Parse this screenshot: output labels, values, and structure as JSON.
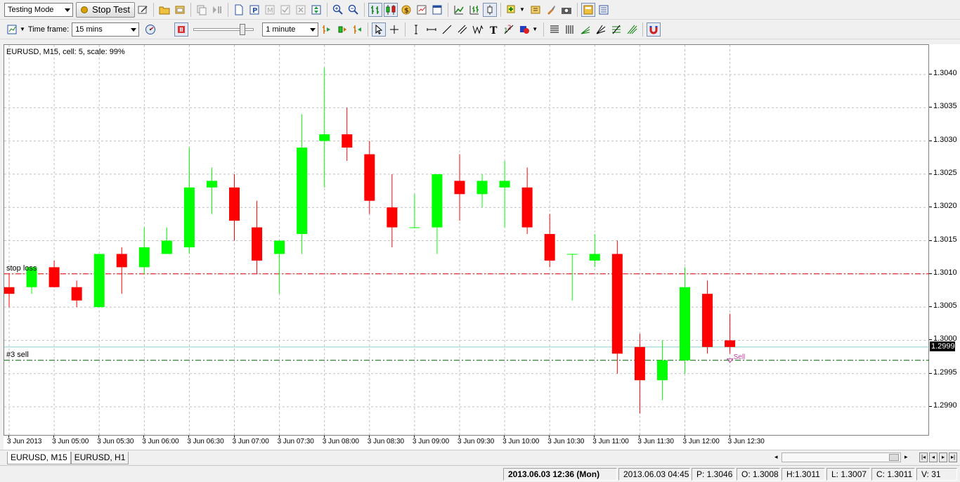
{
  "toolbar1": {
    "mode_select": "Testing Mode",
    "stop_test_label": "Stop Test"
  },
  "toolbar2": {
    "timeframe_label": "Time frame:",
    "timeframe_value": "15 mins",
    "speed_value": "1 minute"
  },
  "chart": {
    "caption": "EURUSD, M15, cell: 5, scale: 99%",
    "stop_loss_label": "stop loss",
    "order_label": "#3 sell",
    "sell_marker": "Sell",
    "current_price": "1.2999",
    "colors": {
      "bull": "#00ff00",
      "bear": "#ff0000",
      "grid": "#c0c0c0",
      "stoploss": "#e00000",
      "order": "#006000",
      "bidline": "#88d0d0"
    }
  },
  "chart_data": {
    "type": "candlestick",
    "symbol": "EURUSD",
    "timeframe": "M15",
    "ylim": [
      1.2986,
      1.3047
    ],
    "yticks": [
      "1.3040",
      "1.3035",
      "1.3030",
      "1.3025",
      "1.3020",
      "1.3015",
      "1.3010",
      "1.3005",
      "1.3000",
      "1.2995",
      "1.2990"
    ],
    "xticks": [
      "3 Jun 2013",
      "3 Jun 05:00",
      "3 Jun 05:30",
      "3 Jun 06:00",
      "3 Jun 06:30",
      "3 Jun 07:00",
      "3 Jun 07:30",
      "3 Jun 08:00",
      "3 Jun 08:30",
      "3 Jun 09:00",
      "3 Jun 09:30",
      "3 Jun 10:00",
      "3 Jun 10:30",
      "3 Jun 11:00",
      "3 Jun 11:30",
      "3 Jun 12:00",
      "3 Jun 12:30"
    ],
    "stop_loss": 1.301,
    "order_price": 1.2997,
    "bid": 1.2999,
    "candles": [
      {
        "o": 1.3008,
        "h": 1.301,
        "l": 1.3005,
        "c": 1.3007
      },
      {
        "o": 1.3008,
        "h": 1.3011,
        "l": 1.3007,
        "c": 1.3011
      },
      {
        "o": 1.3011,
        "h": 1.3012,
        "l": 1.3008,
        "c": 1.3008
      },
      {
        "o": 1.3008,
        "h": 1.3009,
        "l": 1.3005,
        "c": 1.3006
      },
      {
        "o": 1.3005,
        "h": 1.3013,
        "l": 1.3005,
        "c": 1.3013
      },
      {
        "o": 1.3013,
        "h": 1.3014,
        "l": 1.3007,
        "c": 1.3011
      },
      {
        "o": 1.3011,
        "h": 1.3017,
        "l": 1.301,
        "c": 1.3014
      },
      {
        "o": 1.3013,
        "h": 1.3017,
        "l": 1.3013,
        "c": 1.3015
      },
      {
        "o": 1.3014,
        "h": 1.3029,
        "l": 1.3013,
        "c": 1.3023
      },
      {
        "o": 1.3023,
        "h": 1.3026,
        "l": 1.3019,
        "c": 1.3024
      },
      {
        "o": 1.3023,
        "h": 1.3025,
        "l": 1.3015,
        "c": 1.3018
      },
      {
        "o": 1.3017,
        "h": 1.3021,
        "l": 1.301,
        "c": 1.3012
      },
      {
        "o": 1.3013,
        "h": 1.3015,
        "l": 1.3007,
        "c": 1.3015
      },
      {
        "o": 1.3016,
        "h": 1.3034,
        "l": 1.3013,
        "c": 1.3029
      },
      {
        "o": 1.303,
        "h": 1.3041,
        "l": 1.3023,
        "c": 1.3031
      },
      {
        "o": 1.3031,
        "h": 1.3035,
        "l": 1.3027,
        "c": 1.3029
      },
      {
        "o": 1.3028,
        "h": 1.303,
        "l": 1.3019,
        "c": 1.3021
      },
      {
        "o": 1.302,
        "h": 1.3025,
        "l": 1.3014,
        "c": 1.3017
      },
      {
        "o": 1.3017,
        "h": 1.3022,
        "l": 1.3017,
        "c": 1.3017
      },
      {
        "o": 1.3017,
        "h": 1.3025,
        "l": 1.3013,
        "c": 1.3025
      },
      {
        "o": 1.3024,
        "h": 1.3028,
        "l": 1.3018,
        "c": 1.3022
      },
      {
        "o": 1.3022,
        "h": 1.3025,
        "l": 1.302,
        "c": 1.3024
      },
      {
        "o": 1.3023,
        "h": 1.3027,
        "l": 1.3017,
        "c": 1.3024
      },
      {
        "o": 1.3023,
        "h": 1.3026,
        "l": 1.3016,
        "c": 1.3017
      },
      {
        "o": 1.3016,
        "h": 1.3019,
        "l": 1.3011,
        "c": 1.3012
      },
      {
        "o": 1.3013,
        "h": 1.3013,
        "l": 1.3006,
        "c": 1.3013
      },
      {
        "o": 1.3012,
        "h": 1.3016,
        "l": 1.3011,
        "c": 1.3013
      },
      {
        "o": 1.3013,
        "h": 1.3015,
        "l": 1.2995,
        "c": 1.2998
      },
      {
        "o": 1.2999,
        "h": 1.3001,
        "l": 1.2989,
        "c": 1.2994
      },
      {
        "o": 1.2994,
        "h": 1.3,
        "l": 1.2991,
        "c": 1.2997
      },
      {
        "o": 1.2997,
        "h": 1.3011,
        "l": 1.2995,
        "c": 1.3008
      },
      {
        "o": 1.3007,
        "h": 1.3009,
        "l": 1.2998,
        "c": 1.2999
      },
      {
        "o": 1.3,
        "h": 1.3004,
        "l": 1.2998,
        "c": 1.2999
      }
    ]
  },
  "tabs": [
    "EURUSD, M15",
    "EURUSD, H1"
  ],
  "status": {
    "datetime": "2013.06.03 12:36 (Mon)",
    "bar_time": "2013.06.03 04:45",
    "p": "P: 1.3046",
    "o": "O: 1.3008",
    "h": "H:1.3011",
    "l": "L: 1.3007",
    "c": "C: 1.3011",
    "v": "V: 31"
  }
}
